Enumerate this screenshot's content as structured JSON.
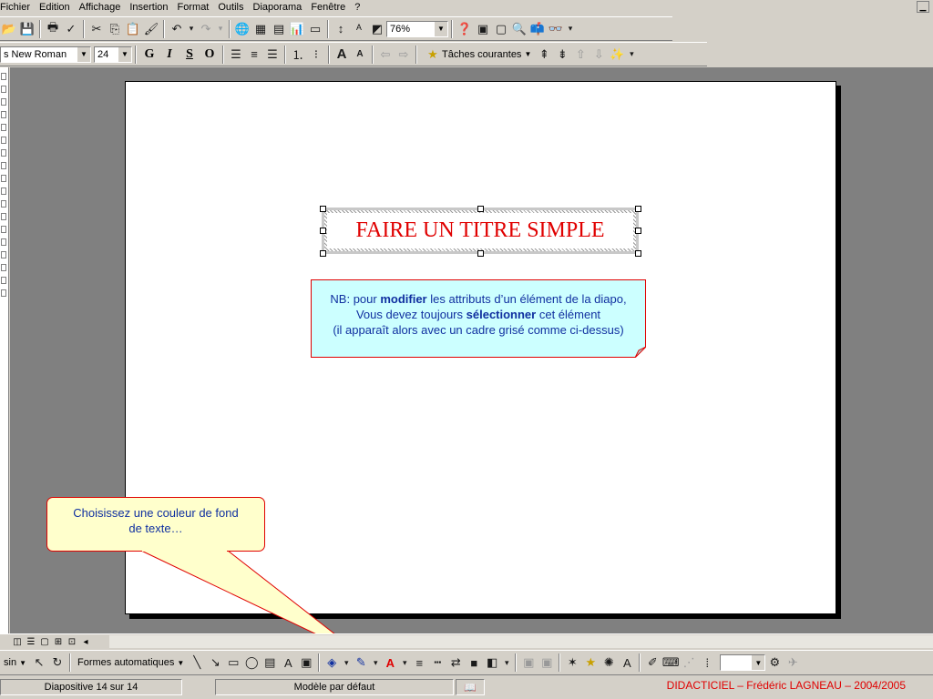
{
  "menubar": {
    "items": [
      {
        "label": "Fichier"
      },
      {
        "label": "Edition"
      },
      {
        "label": "Affichage"
      },
      {
        "label": "Insertion"
      },
      {
        "label": "Format"
      },
      {
        "label": "Outils"
      },
      {
        "label": "Diaporama"
      },
      {
        "label": "Fenêtre"
      },
      {
        "label": "?"
      }
    ]
  },
  "standard_toolbar": {
    "zoom_value": "76%"
  },
  "format_toolbar": {
    "font_name": "s New Roman",
    "font_size": "24",
    "bold_label": "G",
    "italic_label": "I",
    "underline_label": "S",
    "shadow_label": "O",
    "tasks_label": "Tâches courantes"
  },
  "slide": {
    "title": "FAIRE UN TITRE SIMPLE",
    "note": {
      "line1_prefix": "NB: pour ",
      "line1_bold": "modifier",
      "line1_suffix": " les attributs d’un élément de la diapo,",
      "line2_prefix": "Vous devez toujours ",
      "line2_bold": "sélectionner",
      "line2_suffix": " cet élément",
      "line3": "(il apparaît alors avec un cadre grisé comme ci-dessus)"
    },
    "callout": {
      "line1": "Choisissez une couleur de fond",
      "line2": "de texte…"
    }
  },
  "drawing_toolbar": {
    "draw_label": "sin",
    "autoshapes_label": "Formes automatiques"
  },
  "statusbar": {
    "slide_position": "Diapositive 14 sur 14",
    "template": "Modèle par défaut",
    "credit": "DIDACTICIEL – Frédéric LAGNEAU – 2004/2005"
  },
  "colors": {
    "title_red": "#e00000",
    "note_blue": "#1030a0",
    "note_fill": "#ccffff",
    "callout_fill": "#ffffcc"
  }
}
